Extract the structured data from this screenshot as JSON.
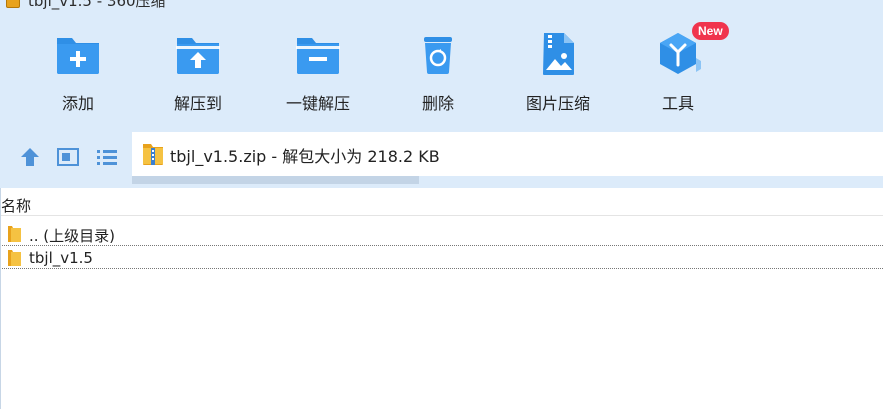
{
  "window": {
    "title": "tbjl_v1.5 - 360压缩"
  },
  "toolbar": {
    "items": [
      {
        "label": "添加",
        "icon": "add-folder-icon"
      },
      {
        "label": "解压到",
        "icon": "extract-to-icon"
      },
      {
        "label": "一键解压",
        "icon": "one-click-extract-icon"
      },
      {
        "label": "删除",
        "icon": "recycle-bin-icon"
      },
      {
        "label": "图片压缩",
        "icon": "image-compress-icon"
      },
      {
        "label": "工具",
        "icon": "tools-cube-icon",
        "badge": "New"
      }
    ]
  },
  "nav": {
    "path_text": "tbjl_v1.5.zip - 解包大小为 218.2 KB"
  },
  "filelist": {
    "header": {
      "name": "名称"
    },
    "rows": [
      {
        "name": ".. (上级目录)"
      },
      {
        "name": "tbjl_v1.5"
      }
    ]
  },
  "colors": {
    "toolbar_bg": "#dcebfa",
    "icon_blue": "#2f8fe6",
    "badge_red": "#f0344d",
    "folder_yellow": "#f5c242"
  }
}
